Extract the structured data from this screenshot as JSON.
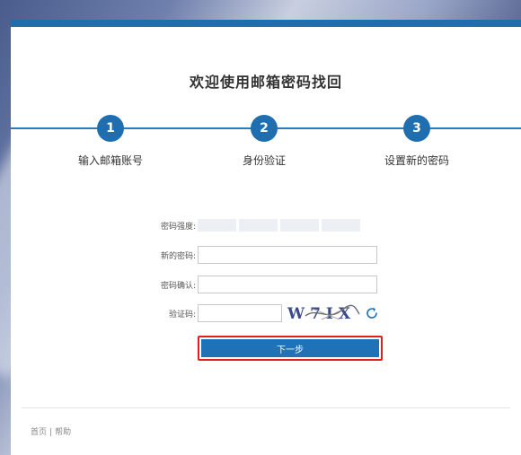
{
  "page": {
    "title": "欢迎使用邮箱密码找回"
  },
  "steps": [
    {
      "number": "1",
      "label": "输入邮箱账号"
    },
    {
      "number": "2",
      "label": "身份验证"
    },
    {
      "number": "3",
      "label": "设置新的密码"
    }
  ],
  "form": {
    "strength_label": "密码强度:",
    "new_password_label": "新的密码:",
    "confirm_password_label": "密码确认:",
    "captcha_label": "验证码:",
    "captcha_text": "W7IX",
    "submit_label": "下一步"
  },
  "footer": {
    "home_link": "首页",
    "separator": "|",
    "help_link": "帮助"
  },
  "colors": {
    "primary": "#1f72b5",
    "highlight_border": "#e02020"
  }
}
